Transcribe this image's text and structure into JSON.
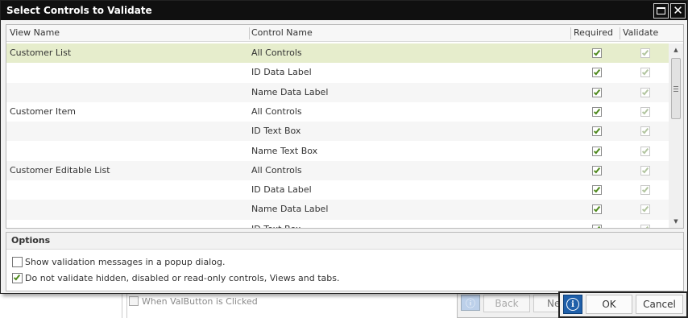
{
  "dialog": {
    "title": "Select Controls to Validate"
  },
  "grid": {
    "columns": {
      "view_name": "View Name",
      "control_name": "Control Name",
      "required": "Required",
      "validate": "Validate"
    },
    "rows": [
      {
        "view": "Customer List",
        "control": "All Controls",
        "required": true,
        "validate": true
      },
      {
        "view": "",
        "control": "ID Data Label",
        "required": true,
        "validate": true
      },
      {
        "view": "",
        "control": "Name Data Label",
        "required": true,
        "validate": true
      },
      {
        "view": "Customer Item",
        "control": "All Controls",
        "required": true,
        "validate": true
      },
      {
        "view": "",
        "control": "ID Text Box",
        "required": true,
        "validate": true
      },
      {
        "view": "",
        "control": "Name Text Box",
        "required": true,
        "validate": true
      },
      {
        "view": "Customer Editable List",
        "control": "All Controls",
        "required": true,
        "validate": true
      },
      {
        "view": "",
        "control": "ID Data Label",
        "required": true,
        "validate": true
      },
      {
        "view": "",
        "control": "Name Data Label",
        "required": true,
        "validate": true
      },
      {
        "view": "",
        "control": "ID Text Box",
        "required": true,
        "validate": true
      }
    ]
  },
  "options": {
    "header": "Options",
    "show_popup": {
      "label": "Show validation messages in a popup dialog.",
      "checked": false
    },
    "skip_hidden": {
      "label": "Do not validate hidden, disabled or read-only controls, Views and tabs.",
      "checked": true
    }
  },
  "buttons": {
    "ok": "OK",
    "cancel": "Cancel"
  },
  "background": {
    "event_text": "When ValButton is Clicked",
    "back_label": "Back",
    "next_label": "Ne"
  },
  "colors": {
    "title_bar": "#101010",
    "selected_row": "#e6edcc",
    "check": "#4f8a1d",
    "info_button": "#1f5fa9"
  }
}
